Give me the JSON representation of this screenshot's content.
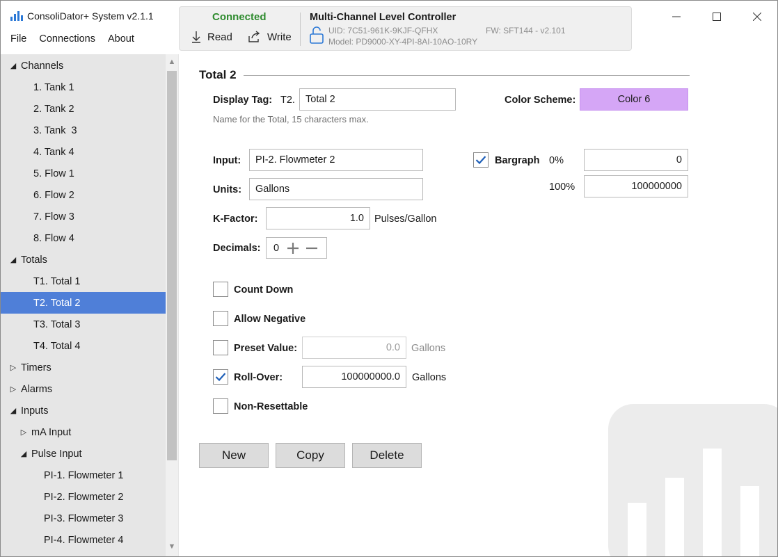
{
  "app": {
    "title": "ConsoliDator+ System v2.1.1"
  },
  "menu": {
    "file": "File",
    "connections": "Connections",
    "about": "About"
  },
  "window_controls": {
    "minimize": "—",
    "maximize": "☐",
    "close": "✕"
  },
  "status": {
    "connection": "Connected",
    "read_label": "Read",
    "write_label": "Write",
    "device_name": "Multi-Channel Level Controller",
    "uid": "UID: 7C51-961K-9KJF-QFHX",
    "model": "Model: PD9000-XY-4PI-8AI-10AO-10RY",
    "fw": "FW: SFT144 - v2.101",
    "connection_color": "#2e8b2e"
  },
  "sidebar": {
    "channels": "Channels",
    "channel_items": [
      "1. Tank 1",
      "2. Tank 2",
      "3. Tank  3",
      "4. Tank 4",
      "5. Flow 1",
      "6. Flow 2",
      "7. Flow 3",
      "8. Flow 4"
    ],
    "totals": "Totals",
    "total_items": [
      "T1. Total 1",
      "T2. Total 2",
      "T3. Total 3",
      "T4. Total 4"
    ],
    "timers": "Timers",
    "alarms": "Alarms",
    "inputs": "Inputs",
    "ma_input": "mA Input",
    "pulse_input": "Pulse Input",
    "pulse_items": [
      "PI-1. Flowmeter 1",
      "PI-2. Flowmeter 2",
      "PI-3. Flowmeter 3",
      "PI-4. Flowmeter 4"
    ],
    "selected_color": "#4f7fd8"
  },
  "form": {
    "section_title": "Total 2",
    "display_tag_label": "Display Tag:",
    "display_tag_prefix": "T2.",
    "display_tag_value": "Total 2",
    "display_tag_hint": "Name for the Total, 15 characters max.",
    "color_scheme_label": "Color Scheme:",
    "color_scheme_value": "Color 6",
    "color_scheme_swatch": "#d5a6f6",
    "input_label": "Input:",
    "input_value": "PI-2. Flowmeter 2",
    "units_label": "Units:",
    "units_value": "Gallons",
    "kfactor_label": "K-Factor:",
    "kfactor_value": "1.0",
    "kfactor_unit": "Pulses/Gallon",
    "decimals_label": "Decimals:",
    "decimals_value": "0",
    "bargraph_label": "Bargraph",
    "bargraph_checked": true,
    "bargraph_min_label": "0%",
    "bargraph_min_value": "0",
    "bargraph_max_label": "100%",
    "bargraph_max_value": "100000000",
    "count_down_label": "Count Down",
    "allow_negative_label": "Allow Negative",
    "preset_label": "Preset Value:",
    "preset_value": "0.0",
    "preset_unit": "Gallons",
    "rollover_label": "Roll-Over:",
    "rollover_checked": true,
    "rollover_value": "100000000.0",
    "rollover_unit": "Gallons",
    "non_resettable_label": "Non-Resettable"
  },
  "buttons": {
    "new": "New",
    "copy": "Copy",
    "delete": "Delete"
  }
}
